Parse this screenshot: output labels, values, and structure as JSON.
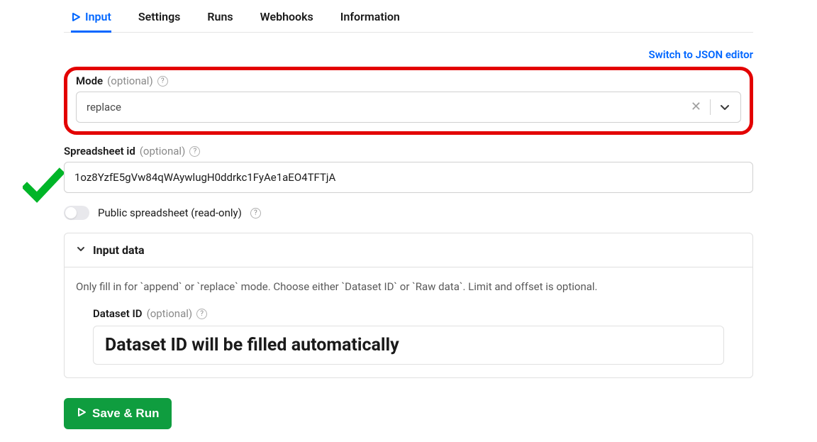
{
  "tabs": {
    "input": "Input",
    "settings": "Settings",
    "runs": "Runs",
    "webhooks": "Webhooks",
    "information": "Information"
  },
  "links": {
    "switch_json": "Switch to JSON editor"
  },
  "fields": {
    "mode": {
      "label": "Mode",
      "optional": "(optional)",
      "value": "replace"
    },
    "spreadsheet_id": {
      "label": "Spreadsheet id",
      "optional": "(optional)",
      "value": "1oz8YzfE5gVw84qWAywlugH0ddrkc1FyAe1aEO4TFTjA"
    },
    "public_spreadsheet": {
      "label": "Public spreadsheet (read-only)"
    }
  },
  "panel": {
    "title": "Input data",
    "description": "Only fill in for `append` or `replace` mode. Choose either `Dataset ID` or `Raw data`. Limit and offset is optional.",
    "dataset_id": {
      "label": "Dataset ID",
      "optional": "(optional)",
      "value": "Dataset ID will be filled automatically"
    }
  },
  "buttons": {
    "save_run": "Save & Run"
  }
}
